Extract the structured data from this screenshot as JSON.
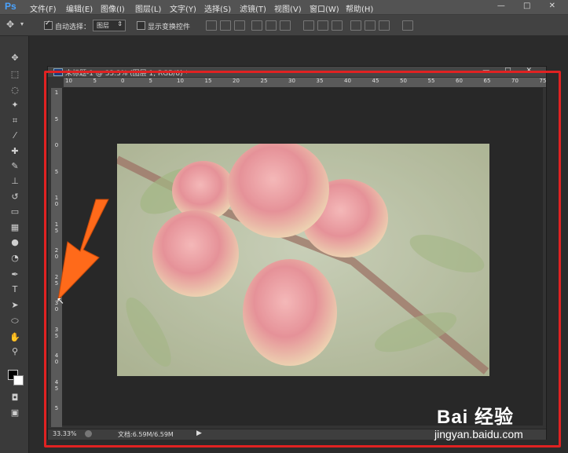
{
  "app": {
    "logo": "Ps"
  },
  "menu": [
    "文件(F)",
    "编辑(E)",
    "图像(I)",
    "图层(L)",
    "文字(Y)",
    "选择(S)",
    "滤镜(T)",
    "视图(V)",
    "窗口(W)",
    "帮助(H)"
  ],
  "window_controls": "— □ ✕",
  "options": {
    "auto_select_label": "自动选择：",
    "auto_select_checked": true,
    "layer_value": "图层",
    "show_transform_label": "显示变换控件",
    "show_transform_checked": false
  },
  "document": {
    "title": "未标题-1 @ 33.3% (图层 1, RGB/8) *",
    "ruler_top": [
      "10",
      "5",
      "0",
      "5",
      "10",
      "15",
      "20",
      "25",
      "30",
      "35",
      "40",
      "45",
      "50",
      "55",
      "60",
      "65",
      "70",
      "75"
    ],
    "ruler_left": [
      "1",
      "5",
      "0",
      "5",
      "1 0",
      "1 5",
      "2 0",
      "2 5",
      "3 0",
      "3 5",
      "4 0",
      "4 5",
      "5"
    ],
    "zoom": "33.33%",
    "doc_size": "文档:6.59M/6.59M"
  },
  "watermark": {
    "brand": "Bai 经验",
    "url": "jingyan.baidu.com"
  },
  "colors": {
    "highlight": "#e02222",
    "arrow": "#ff6a1a"
  }
}
